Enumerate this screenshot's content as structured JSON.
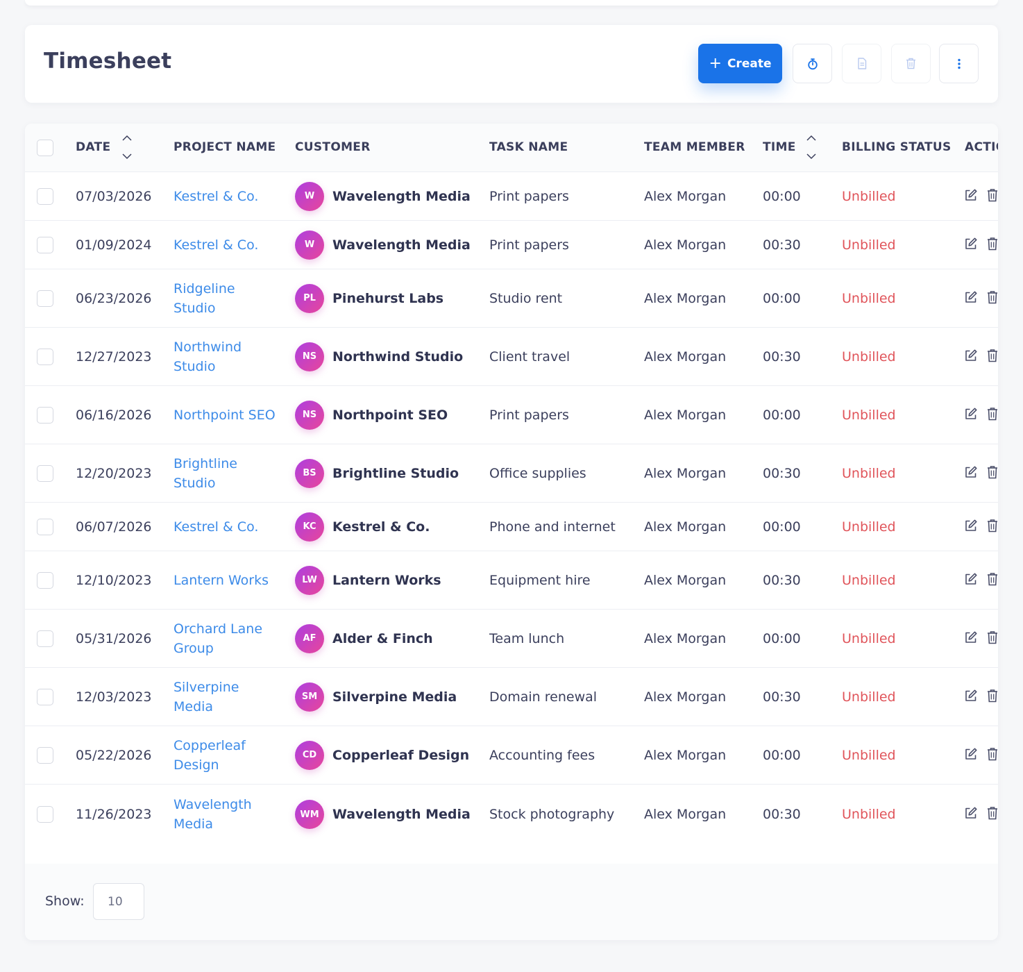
{
  "page": {
    "title": "Timesheet",
    "create_label": "Create",
    "colors": {
      "primary": "#1a73e8",
      "link": "#3d8be8",
      "unbilled": "#e0545a"
    }
  },
  "table": {
    "columns": [
      "DATE",
      "PROJECT NAME",
      "CUSTOMER",
      "TASK NAME",
      "TEAM MEMBER",
      "TIME",
      "BILLING STATUS",
      "ACTIO"
    ],
    "rows": [
      {
        "date": "07/03/2026",
        "project": "Kestrel & Co.",
        "initials": "W",
        "customer": "Wavelength Media",
        "task": "Print papers",
        "member": "Alex Morgan",
        "time": "00:00",
        "status": "Unbilled"
      },
      {
        "date": "01/09/2024",
        "project": "Kestrel & Co.",
        "initials": "W",
        "customer": "Wavelength Media",
        "task": "Print papers",
        "member": "Alex Morgan",
        "time": "00:30",
        "status": "Unbilled"
      },
      {
        "date": "06/23/2026",
        "project": "Ridgeline Studio",
        "initials": "PL",
        "customer": "Pinehurst Labs",
        "task": "Studio rent",
        "member": "Alex Morgan",
        "time": "00:00",
        "status": "Unbilled"
      },
      {
        "date": "12/27/2023",
        "project": "Northwind Studio",
        "initials": "NS",
        "customer": "Northwind Studio",
        "task": "Client travel",
        "member": "Alex Morgan",
        "time": "00:30",
        "status": "Unbilled"
      },
      {
        "date": "06/16/2026",
        "project": "Northpoint SEO",
        "initials": "NS",
        "customer": "Northpoint SEO",
        "task": "Print papers",
        "member": "Alex Morgan",
        "time": "00:00",
        "status": "Unbilled"
      },
      {
        "date": "12/20/2023",
        "project": "Brightline Studio",
        "initials": "BS",
        "customer": "Brightline Studio",
        "task": "Office supplies",
        "member": "Alex Morgan",
        "time": "00:30",
        "status": "Unbilled"
      },
      {
        "date": "06/07/2026",
        "project": "Kestrel & Co.",
        "initials": "KC",
        "customer": "Kestrel & Co.",
        "task": "Phone and internet",
        "member": "Alex Morgan",
        "time": "00:00",
        "status": "Unbilled"
      },
      {
        "date": "12/10/2023",
        "project": "Lantern Works",
        "initials": "LW",
        "customer": "Lantern Works",
        "task": "Equipment hire",
        "member": "Alex Morgan",
        "time": "00:30",
        "status": "Unbilled"
      },
      {
        "date": "05/31/2026",
        "project": "Orchard Lane Group",
        "initials": "AF",
        "customer": "Alder & Finch",
        "task": "Team lunch",
        "member": "Alex Morgan",
        "time": "00:00",
        "status": "Unbilled"
      },
      {
        "date": "12/03/2023",
        "project": "Silverpine Media",
        "initials": "SM",
        "customer": "Silverpine Media",
        "task": "Domain renewal",
        "member": "Alex Morgan",
        "time": "00:30",
        "status": "Unbilled"
      },
      {
        "date": "05/22/2026",
        "project": "Copperleaf Design",
        "initials": "CD",
        "customer": "Copperleaf Design",
        "task": "Accounting fees",
        "member": "Alex Morgan",
        "time": "00:00",
        "status": "Unbilled"
      },
      {
        "date": "11/26/2023",
        "project": "Wavelength Media",
        "initials": "WM",
        "customer": "Wavelength Media",
        "task": "Stock photography",
        "member": "Alex Morgan",
        "time": "00:30",
        "status": "Unbilled"
      }
    ]
  },
  "footer": {
    "show_label": "Show:",
    "page_size": "10"
  }
}
